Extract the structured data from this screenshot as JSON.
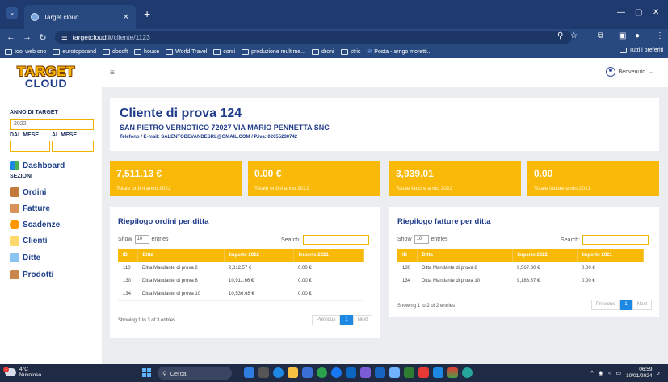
{
  "browser": {
    "tab_title": "Target cloud",
    "url_domain": "targetcloud.it",
    "url_path": "/cliente/1123",
    "bookmarks": [
      "tool web sno",
      "eurotopbrand",
      "dbsoft",
      "house",
      "World Travel",
      "corsi",
      "produzione multime...",
      "droni",
      "stric",
      "Posta - arrigo moretti..."
    ],
    "bookmarks_all": "Tutti i preferiti"
  },
  "sidebar": {
    "logo_line1": "TARGET",
    "logo_line2": "CLOUD",
    "anno_label": "ANNO DI TARGET",
    "anno_value": "2022",
    "dal_mese_label": "DAL MESE",
    "al_mese_label": "AL MESE",
    "sezioni_label": "SEZIONI",
    "items": [
      {
        "label": "Dashboard",
        "icon": "dashboard-icon"
      },
      {
        "label": "Ordini",
        "icon": "ordini-icon"
      },
      {
        "label": "Fatture",
        "icon": "fatture-icon"
      },
      {
        "label": "Scadenze",
        "icon": "scadenze-icon"
      },
      {
        "label": "Clienti",
        "icon": "clienti-icon"
      },
      {
        "label": "Ditte",
        "icon": "ditte-icon"
      },
      {
        "label": "Prodotti",
        "icon": "prodotti-icon"
      }
    ]
  },
  "topbar": {
    "user_label": "Benvenuto"
  },
  "client": {
    "name": "Cliente di prova 124",
    "address": "SAN PIETRO VERNOTICO 72027 VIA MARIO PENNETTA SNC",
    "contact": "Telefono / E-mail: SALENTOBEVANDESRL@GMAIL.COM / P.iva: 02655230742"
  },
  "stats": [
    {
      "value": "7,511.13 €",
      "label": "Totale ordini anno 2022"
    },
    {
      "value": "0.00 €",
      "label": "Totale ordini anno 2021"
    },
    {
      "value": "3,939.01",
      "label": "Totale fatture anno 2022"
    },
    {
      "value": "0.00",
      "label": "Totale fatture anno 2021"
    }
  ],
  "ordini_panel": {
    "title": "Riepilogo ordini per ditta",
    "show": "Show",
    "entries": "entries",
    "per_page": "10",
    "search": "Search:",
    "columns": [
      "ID",
      "Ditta",
      "Importo 2022",
      "Importo 2021"
    ],
    "rows": [
      [
        "110",
        "Ditta Mandante di prova 2",
        "2,812.57 €",
        "0.00 €"
      ],
      [
        "130",
        "Ditta Mandante di prova 8",
        "10,911.66 €",
        "0.00 €"
      ],
      [
        "134",
        "Ditta Mandante di prova 10",
        "10,536.68 €",
        "0.00 €"
      ]
    ],
    "info": "Showing 1 to 3 of 3 entries",
    "prev": "Previous",
    "page": "1",
    "next": "Next"
  },
  "fatture_panel": {
    "title": "Riepilogo fatture per ditta",
    "show": "Show",
    "entries": "entries",
    "per_page": "10",
    "search": "Search:",
    "columns": [
      "ID",
      "Ditta",
      "Importo 2022",
      "Importo 2021"
    ],
    "rows": [
      [
        "130",
        "Ditta Mandante di prova 8",
        "9,567.30 €",
        "0.00 €"
      ],
      [
        "134",
        "Ditta Mandante di prova 10",
        "9,188.37 €",
        "0.00 €"
      ]
    ],
    "info": "Showing 1 to 2 of 2 entries",
    "prev": "Previous",
    "page": "1",
    "next": "Next"
  },
  "taskbar": {
    "temp": "4°C",
    "weather": "Nuvoloso",
    "weather_badge": "1",
    "search": "Cerca",
    "time": "06:59",
    "date": "10/01/2024"
  },
  "colors": {
    "accent": "#f9b908",
    "brand_blue": "#1f3b8a",
    "chrome": "#28497f"
  }
}
